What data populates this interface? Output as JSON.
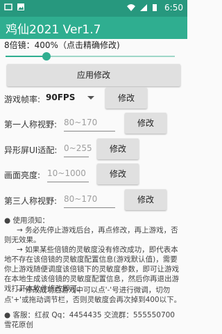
{
  "status": {
    "time": "6:50"
  },
  "app": {
    "title": "鸡仙2021 Ver1.7"
  },
  "zoom": {
    "label": "8倍镜：400%（点击精确修改)",
    "level_fraction": 0.24
  },
  "buttons": {
    "apply": "应用修改",
    "modify": "修改"
  },
  "fps": {
    "label": "游戏帧率:",
    "value": "90FPS"
  },
  "fields": [
    {
      "label": "第一人称视野:",
      "placeholder": "80~170"
    },
    {
      "label": "异形屏UI适配:",
      "placeholder": "0~255"
    },
    {
      "label": "画面亮度:",
      "placeholder": "10~1000"
    },
    {
      "label": "第三人称视野:",
      "placeholder": "80~170"
    }
  ],
  "notes": {
    "n1": "● 使用须知：",
    "n2": "→ 务必先停止游戏后台，再点修改，再上游戏，否则无效果。",
    "n3": "→ 如果某些倍镜的灵敏度没有修改成功，即代表本地不存在该倍镜的灵敏度配置信息(游戏默认值)，需要你上游戏随便调度该倍镜下的灵敏度参数，即可让游戏在本地生成该倍镜的灵敏度配置信息，然后你再退出游戏打开本软件修改即可。",
    "n4": "→ 修改成功后游戏中可以点'-'号进行微调，切勿点'+'或拖动调节栏，否则灵敏度会再次掉到400以下。",
    "n5": "● 客服：红叔 Qq：4454435 交流群：555550700 雪花原创"
  }
}
